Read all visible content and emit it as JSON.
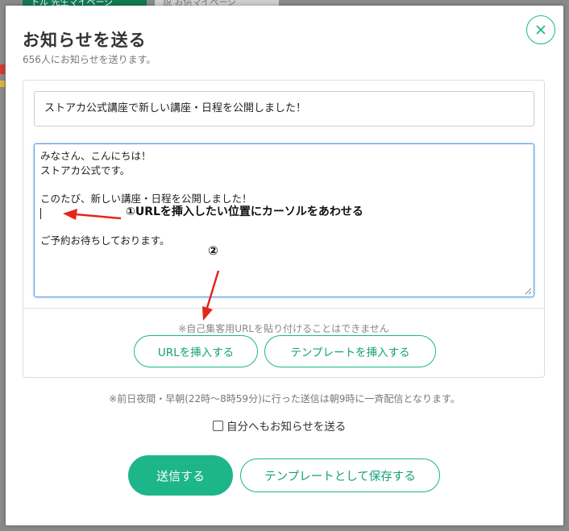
{
  "background": {
    "tab_left": "トル 先生マイページ",
    "tab_right": "説 お供マイページ"
  },
  "modal": {
    "title": "お知らせを送る",
    "subtitle": "656人にお知らせを送ります。",
    "close_icon": "close-icon"
  },
  "form": {
    "subject": "ストアカ公式講座で新しい講座・日程を公開しました！",
    "body_lines": [
      "みなさん、こんにちは！",
      "ストアカ公式です。",
      "",
      "このたび、新しい講座・日程を公開しました！",
      "",
      "",
      "ご予約お待ちしております。"
    ],
    "url_note": "※自己集客用URLを貼り付けることはできません",
    "insert_url_label": "URLを挿入する",
    "insert_template_label": "テンプレートを挿入する"
  },
  "schedule_note": "※前日夜間・早朝(22時〜8時59分)に行った送信は朝9時に一斉配信となります。",
  "self_notify_label": "自分へもお知らせを送る",
  "self_notify_checked": false,
  "actions": {
    "send_label": "送信する",
    "save_template_label": "テンプレートとして保存する"
  },
  "annotations": {
    "step1": "①URLを挿入したい位置にカーソルをあわせる",
    "step2": "②",
    "arrow_color": "#e3261c"
  },
  "colors": {
    "accent": "#1db58a",
    "backdrop": "#8a8a8a"
  }
}
